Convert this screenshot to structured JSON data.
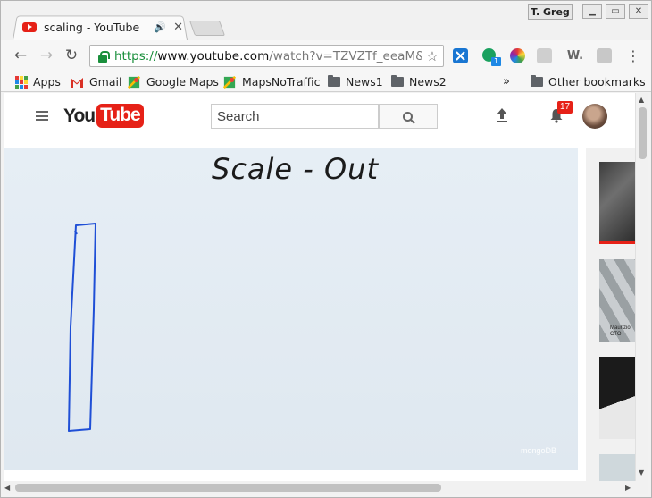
{
  "window": {
    "profile_name": "T. Greg",
    "controls": {
      "minimize": "▭",
      "restore": "◻",
      "close": "✕"
    }
  },
  "tabs": [
    {
      "title": "scaling - YouTube",
      "favicon": "youtube-favicon",
      "audio": "🔊",
      "active": true
    }
  ],
  "toolbar": {
    "url_scheme": "https://",
    "url_host": "www.youtube.com",
    "url_path": "/watch?v=TZVZTf_eeaM&feature=youtu.be",
    "extension_badge": "1"
  },
  "bookmarks": [
    {
      "label": "Apps",
      "icon": "apps-grid-icon"
    },
    {
      "label": "Gmail",
      "icon": "gmail-icon"
    },
    {
      "label": "Google Maps",
      "icon": "maps-icon"
    },
    {
      "label": "MapsNoTraffic",
      "icon": "maps-icon"
    },
    {
      "label": "News1",
      "icon": "folder-icon"
    },
    {
      "label": "News2",
      "icon": "folder-icon"
    }
  ],
  "bookmarks_overflow": "»",
  "other_bookmarks": "Other bookmarks",
  "youtube": {
    "logo_you": "You",
    "logo_tube": "Tube",
    "search_placeholder": "Search",
    "notification_count": "17"
  },
  "video": {
    "board_title": "Scale - Out",
    "watermark": "mongoDB"
  },
  "related": [
    {
      "caption": ""
    },
    {
      "caption": "Maurizio CTO"
    },
    {
      "caption": ""
    }
  ],
  "colors": {
    "youtube_red": "#e62117",
    "secure_green": "#1a8f3c",
    "marker_blue": "#1f4fd6"
  }
}
